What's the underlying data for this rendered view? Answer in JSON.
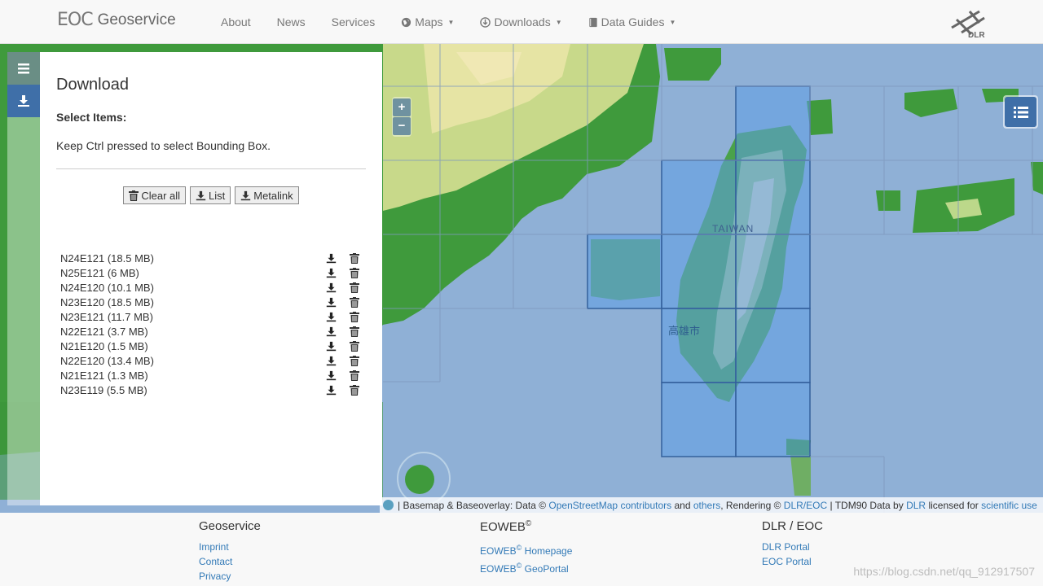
{
  "brand": {
    "logo": "EOC",
    "name": "Geoservice"
  },
  "nav": {
    "about": "About",
    "news": "News",
    "services": "Services",
    "maps": "Maps",
    "downloads": "Downloads",
    "data_guides": "Data Guides"
  },
  "dlr": "DLR",
  "map": {
    "zoom_in": "+",
    "zoom_out": "−",
    "label_taiwan": "TAIWAN",
    "label_kaohsiung": "高雄市"
  },
  "panel": {
    "title": "Download",
    "select_items": "Select Items:",
    "hint": "Keep Ctrl pressed to select Bounding Box.",
    "clear_all": "Clear all",
    "list": "List",
    "metalink": "Metalink",
    "items": [
      "N24E121 (18.5 MB)",
      "N25E121 (6 MB)",
      "N24E120 (10.1 MB)",
      "N23E120 (18.5 MB)",
      "N23E121 (11.7 MB)",
      "N22E121 (3.7 MB)",
      "N21E120 (1.5 MB)",
      "N22E120 (13.4 MB)",
      "N21E121 (1.3 MB)",
      "N23E119 (5.5 MB)"
    ]
  },
  "attribution": {
    "prefix": "| Basemap & Baseoverlay: Data ©",
    "osm": "OpenStreetMap contributors",
    "and": "and",
    "others": "others",
    "rendering": ", Rendering ©",
    "dlr_eoc": "DLR/EOC",
    "tdm": "| TDM90 Data by",
    "dlr": "DLR",
    "licensed": "licensed for",
    "scientific": "scientific use"
  },
  "footer": {
    "col1": {
      "title": "Geoservice",
      "links": [
        "Imprint",
        "Contact",
        "Privacy"
      ]
    },
    "col2": {
      "title": "EOWEB",
      "sup": "©",
      "links": [
        {
          "a": "EOWEB",
          "b": "Homepage"
        },
        {
          "a": "EOWEB",
          "b": "GeoPortal"
        }
      ]
    },
    "col3": {
      "title": "DLR / EOC",
      "links": [
        "DLR Portal",
        "EOC Portal"
      ]
    }
  },
  "watermark": "https://blog.csdn.net/qq_912917507"
}
